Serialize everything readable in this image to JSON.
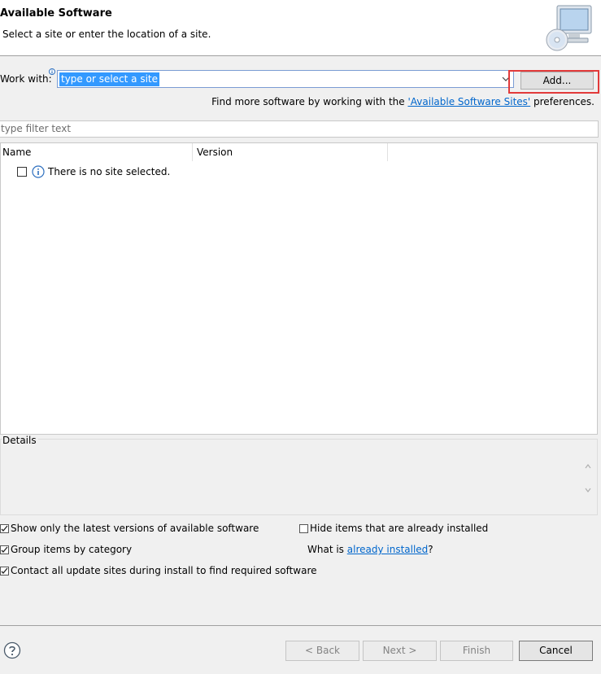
{
  "header": {
    "title": "Available Software",
    "subtitle": "Select a site or enter the location of a site."
  },
  "work_with": {
    "label": "Work with:",
    "value": "type or select a site",
    "add_label": "Add..."
  },
  "findmore": {
    "prefix": "Find more software by working with the ",
    "link": "'Available Software Sites'",
    "suffix": " preferences."
  },
  "filter": {
    "placeholder": "type filter text"
  },
  "table": {
    "columns": [
      "Name",
      "Version"
    ],
    "rows": [
      {
        "text": "There is no site selected.",
        "checked": false
      }
    ]
  },
  "details": {
    "label": "Details"
  },
  "options": {
    "show_latest": {
      "label": "Show only the latest versions of available software",
      "checked": true
    },
    "group_by_category": {
      "label": "Group items by category",
      "checked": true
    },
    "contact_all": {
      "label": "Contact all update sites during install to find required software",
      "checked": true
    },
    "hide_installed": {
      "label": "Hide items that are already installed",
      "checked": false
    },
    "what_is_prefix": "What is ",
    "what_is_link": "already installed",
    "what_is_suffix": "?"
  },
  "buttons": {
    "back": "< Back",
    "next": "Next >",
    "finish": "Finish",
    "cancel": "Cancel"
  },
  "colors": {
    "link": "#0066cc",
    "highlight": "#e23a3a",
    "selection": "#3399ff"
  }
}
